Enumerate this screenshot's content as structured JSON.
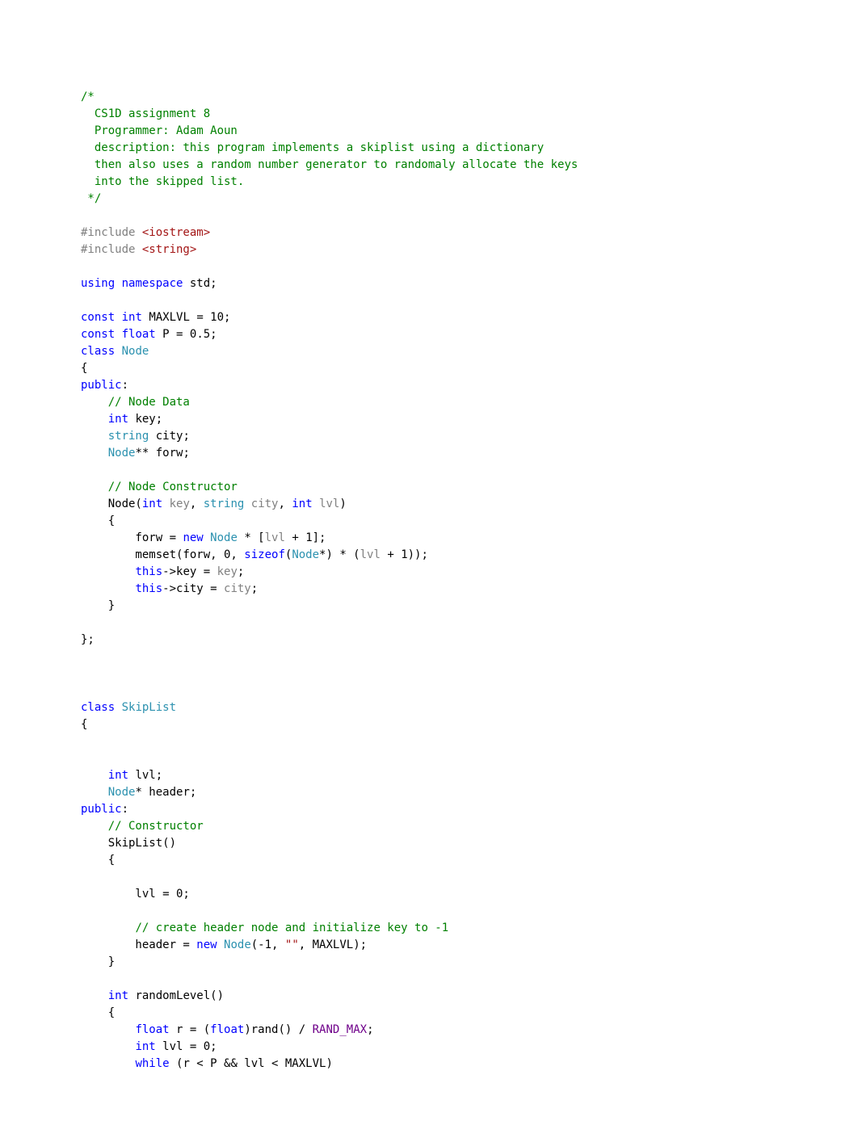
{
  "code": {
    "lines": [
      [
        {
          "c": "comment",
          "t": "/*"
        }
      ],
      [
        {
          "c": "comment",
          "t": "  CS1D assignment 8"
        }
      ],
      [
        {
          "c": "comment",
          "t": "  Programmer: Adam Aoun"
        }
      ],
      [
        {
          "c": "comment",
          "t": "  description: this program implements a skiplist using a dictionary"
        }
      ],
      [
        {
          "c": "comment",
          "t": "  then also uses a random number generator to randomaly allocate the keys"
        }
      ],
      [
        {
          "c": "comment",
          "t": "  into the skipped list."
        }
      ],
      [
        {
          "c": "comment",
          "t": " */"
        }
      ],
      [],
      [
        {
          "c": "preproc",
          "t": "#include "
        },
        {
          "c": "string",
          "t": "<iostream>"
        }
      ],
      [
        {
          "c": "preproc",
          "t": "#include "
        },
        {
          "c": "string",
          "t": "<string>"
        }
      ],
      [],
      [
        {
          "c": "keyword",
          "t": "using"
        },
        {
          "c": "default",
          "t": " "
        },
        {
          "c": "keyword",
          "t": "namespace"
        },
        {
          "c": "default",
          "t": " std;"
        }
      ],
      [],
      [
        {
          "c": "keyword",
          "t": "const"
        },
        {
          "c": "default",
          "t": " "
        },
        {
          "c": "keyword",
          "t": "int"
        },
        {
          "c": "default",
          "t": " MAXLVL = 10;"
        }
      ],
      [
        {
          "c": "keyword",
          "t": "const"
        },
        {
          "c": "default",
          "t": " "
        },
        {
          "c": "keyword",
          "t": "float"
        },
        {
          "c": "default",
          "t": " P = 0.5;"
        }
      ],
      [
        {
          "c": "keyword",
          "t": "class"
        },
        {
          "c": "default",
          "t": " "
        },
        {
          "c": "classname",
          "t": "Node"
        }
      ],
      [
        {
          "c": "default",
          "t": "{"
        }
      ],
      [
        {
          "c": "keyword",
          "t": "public"
        },
        {
          "c": "default",
          "t": ":"
        }
      ],
      [
        {
          "c": "default",
          "t": "    "
        },
        {
          "c": "comment",
          "t": "// Node Data"
        }
      ],
      [
        {
          "c": "default",
          "t": "    "
        },
        {
          "c": "keyword",
          "t": "int"
        },
        {
          "c": "default",
          "t": " key;"
        }
      ],
      [
        {
          "c": "default",
          "t": "    "
        },
        {
          "c": "classname",
          "t": "string"
        },
        {
          "c": "default",
          "t": " city;"
        }
      ],
      [
        {
          "c": "default",
          "t": "    "
        },
        {
          "c": "classname",
          "t": "Node"
        },
        {
          "c": "default",
          "t": "** forw;"
        }
      ],
      [],
      [
        {
          "c": "default",
          "t": "    "
        },
        {
          "c": "comment",
          "t": "// Node Constructor"
        }
      ],
      [
        {
          "c": "default",
          "t": "    Node("
        },
        {
          "c": "keyword",
          "t": "int"
        },
        {
          "c": "default",
          "t": " "
        },
        {
          "c": "param",
          "t": "key"
        },
        {
          "c": "default",
          "t": ", "
        },
        {
          "c": "classname",
          "t": "string"
        },
        {
          "c": "default",
          "t": " "
        },
        {
          "c": "param",
          "t": "city"
        },
        {
          "c": "default",
          "t": ", "
        },
        {
          "c": "keyword",
          "t": "int"
        },
        {
          "c": "default",
          "t": " "
        },
        {
          "c": "param",
          "t": "lvl"
        },
        {
          "c": "default",
          "t": ")"
        }
      ],
      [
        {
          "c": "default",
          "t": "    {"
        }
      ],
      [
        {
          "c": "default",
          "t": "        forw = "
        },
        {
          "c": "keyword",
          "t": "new"
        },
        {
          "c": "default",
          "t": " "
        },
        {
          "c": "classname",
          "t": "Node"
        },
        {
          "c": "default",
          "t": " * ["
        },
        {
          "c": "param",
          "t": "lvl"
        },
        {
          "c": "default",
          "t": " + 1];"
        }
      ],
      [
        {
          "c": "default",
          "t": "        memset(forw, 0, "
        },
        {
          "c": "keyword",
          "t": "sizeof"
        },
        {
          "c": "default",
          "t": "("
        },
        {
          "c": "classname",
          "t": "Node"
        },
        {
          "c": "default",
          "t": "*) * ("
        },
        {
          "c": "param",
          "t": "lvl"
        },
        {
          "c": "default",
          "t": " + 1));"
        }
      ],
      [
        {
          "c": "default",
          "t": "        "
        },
        {
          "c": "keyword",
          "t": "this"
        },
        {
          "c": "default",
          "t": "->key = "
        },
        {
          "c": "param",
          "t": "key"
        },
        {
          "c": "default",
          "t": ";"
        }
      ],
      [
        {
          "c": "default",
          "t": "        "
        },
        {
          "c": "keyword",
          "t": "this"
        },
        {
          "c": "default",
          "t": "->city = "
        },
        {
          "c": "param",
          "t": "city"
        },
        {
          "c": "default",
          "t": ";"
        }
      ],
      [
        {
          "c": "default",
          "t": "    }"
        }
      ],
      [],
      [
        {
          "c": "default",
          "t": "};"
        }
      ],
      [],
      [],
      [],
      [
        {
          "c": "keyword",
          "t": "class"
        },
        {
          "c": "default",
          "t": " "
        },
        {
          "c": "classname",
          "t": "SkipList"
        }
      ],
      [
        {
          "c": "default",
          "t": "{"
        }
      ],
      [],
      [],
      [
        {
          "c": "default",
          "t": "    "
        },
        {
          "c": "keyword",
          "t": "int"
        },
        {
          "c": "default",
          "t": " lvl;"
        }
      ],
      [
        {
          "c": "default",
          "t": "    "
        },
        {
          "c": "classname",
          "t": "Node"
        },
        {
          "c": "default",
          "t": "* header;"
        }
      ],
      [
        {
          "c": "keyword",
          "t": "public"
        },
        {
          "c": "default",
          "t": ":"
        }
      ],
      [
        {
          "c": "default",
          "t": "    "
        },
        {
          "c": "comment",
          "t": "// Constructor"
        }
      ],
      [
        {
          "c": "default",
          "t": "    SkipList()"
        }
      ],
      [
        {
          "c": "default",
          "t": "    {"
        }
      ],
      [],
      [
        {
          "c": "default",
          "t": "        lvl = 0;"
        }
      ],
      [],
      [
        {
          "c": "default",
          "t": "        "
        },
        {
          "c": "comment",
          "t": "// create header node and initialize key to -1"
        }
      ],
      [
        {
          "c": "default",
          "t": "        header = "
        },
        {
          "c": "keyword",
          "t": "new"
        },
        {
          "c": "default",
          "t": " "
        },
        {
          "c": "classname",
          "t": "Node"
        },
        {
          "c": "default",
          "t": "(-1, "
        },
        {
          "c": "string",
          "t": "\"\""
        },
        {
          "c": "default",
          "t": ", MAXLVL);"
        }
      ],
      [
        {
          "c": "default",
          "t": "    }"
        }
      ],
      [],
      [
        {
          "c": "default",
          "t": "    "
        },
        {
          "c": "keyword",
          "t": "int"
        },
        {
          "c": "default",
          "t": " randomLevel()"
        }
      ],
      [
        {
          "c": "default",
          "t": "    {"
        }
      ],
      [
        {
          "c": "default",
          "t": "        "
        },
        {
          "c": "keyword",
          "t": "float"
        },
        {
          "c": "default",
          "t": " r = ("
        },
        {
          "c": "keyword",
          "t": "float"
        },
        {
          "c": "default",
          "t": ")rand() / "
        },
        {
          "c": "macro",
          "t": "RAND_MAX"
        },
        {
          "c": "default",
          "t": ";"
        }
      ],
      [
        {
          "c": "default",
          "t": "        "
        },
        {
          "c": "keyword",
          "t": "int"
        },
        {
          "c": "default",
          "t": " lvl = 0;"
        }
      ],
      [
        {
          "c": "default",
          "t": "        "
        },
        {
          "c": "keyword",
          "t": "while"
        },
        {
          "c": "default",
          "t": " (r < P && lvl < MAXLVL)"
        }
      ]
    ]
  }
}
